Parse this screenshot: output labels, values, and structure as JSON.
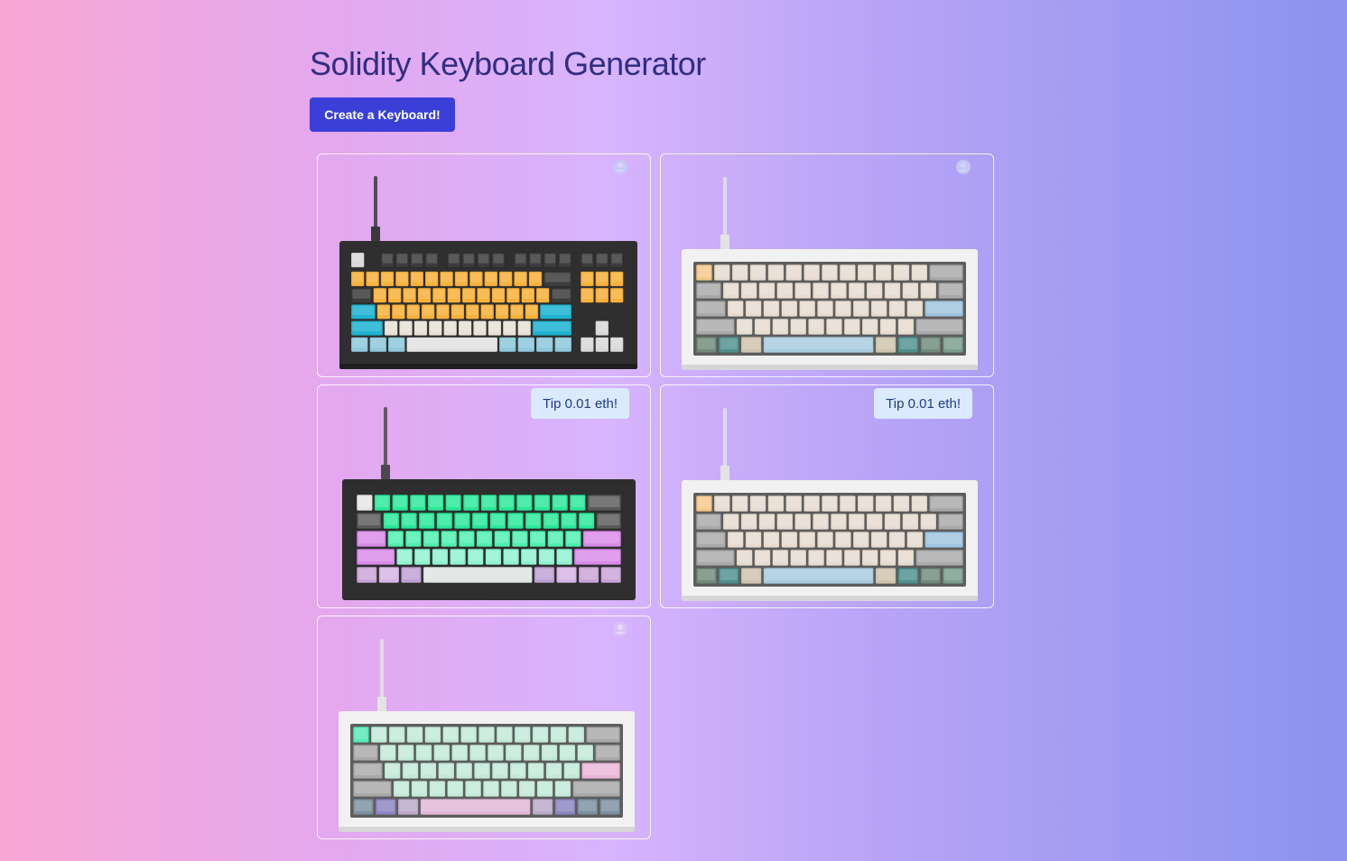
{
  "header": {
    "title": "Solidity Keyboard Generator"
  },
  "actions": {
    "create_label": "Create a Keyboard!"
  },
  "cards": [
    {
      "action": "owner",
      "keyboard": {
        "layout": "tkl",
        "frame": "dark",
        "kind": "yellow-cyan"
      }
    },
    {
      "action": "owner",
      "keyboard": {
        "layout": "sixty",
        "frame": "light",
        "kind": "beige"
      }
    },
    {
      "action": "tip",
      "tip_label": "Tip 0.01 eth!",
      "keyboard": {
        "layout": "sixty",
        "frame": "dark",
        "kind": "green-purple"
      }
    },
    {
      "action": "tip",
      "tip_label": "Tip 0.01 eth!",
      "keyboard": {
        "layout": "sixty",
        "frame": "light",
        "kind": "beige"
      }
    },
    {
      "action": "owner",
      "keyboard": {
        "layout": "sixty",
        "frame": "light",
        "kind": "mint-pink"
      }
    }
  ],
  "colors": {
    "title": "#312e81",
    "create_button_bg": "#3b3fd8",
    "tip_button_bg": "#dbeafe",
    "tip_button_text": "#1e3a8a"
  },
  "icons": {
    "owner": "user-circle-icon"
  }
}
